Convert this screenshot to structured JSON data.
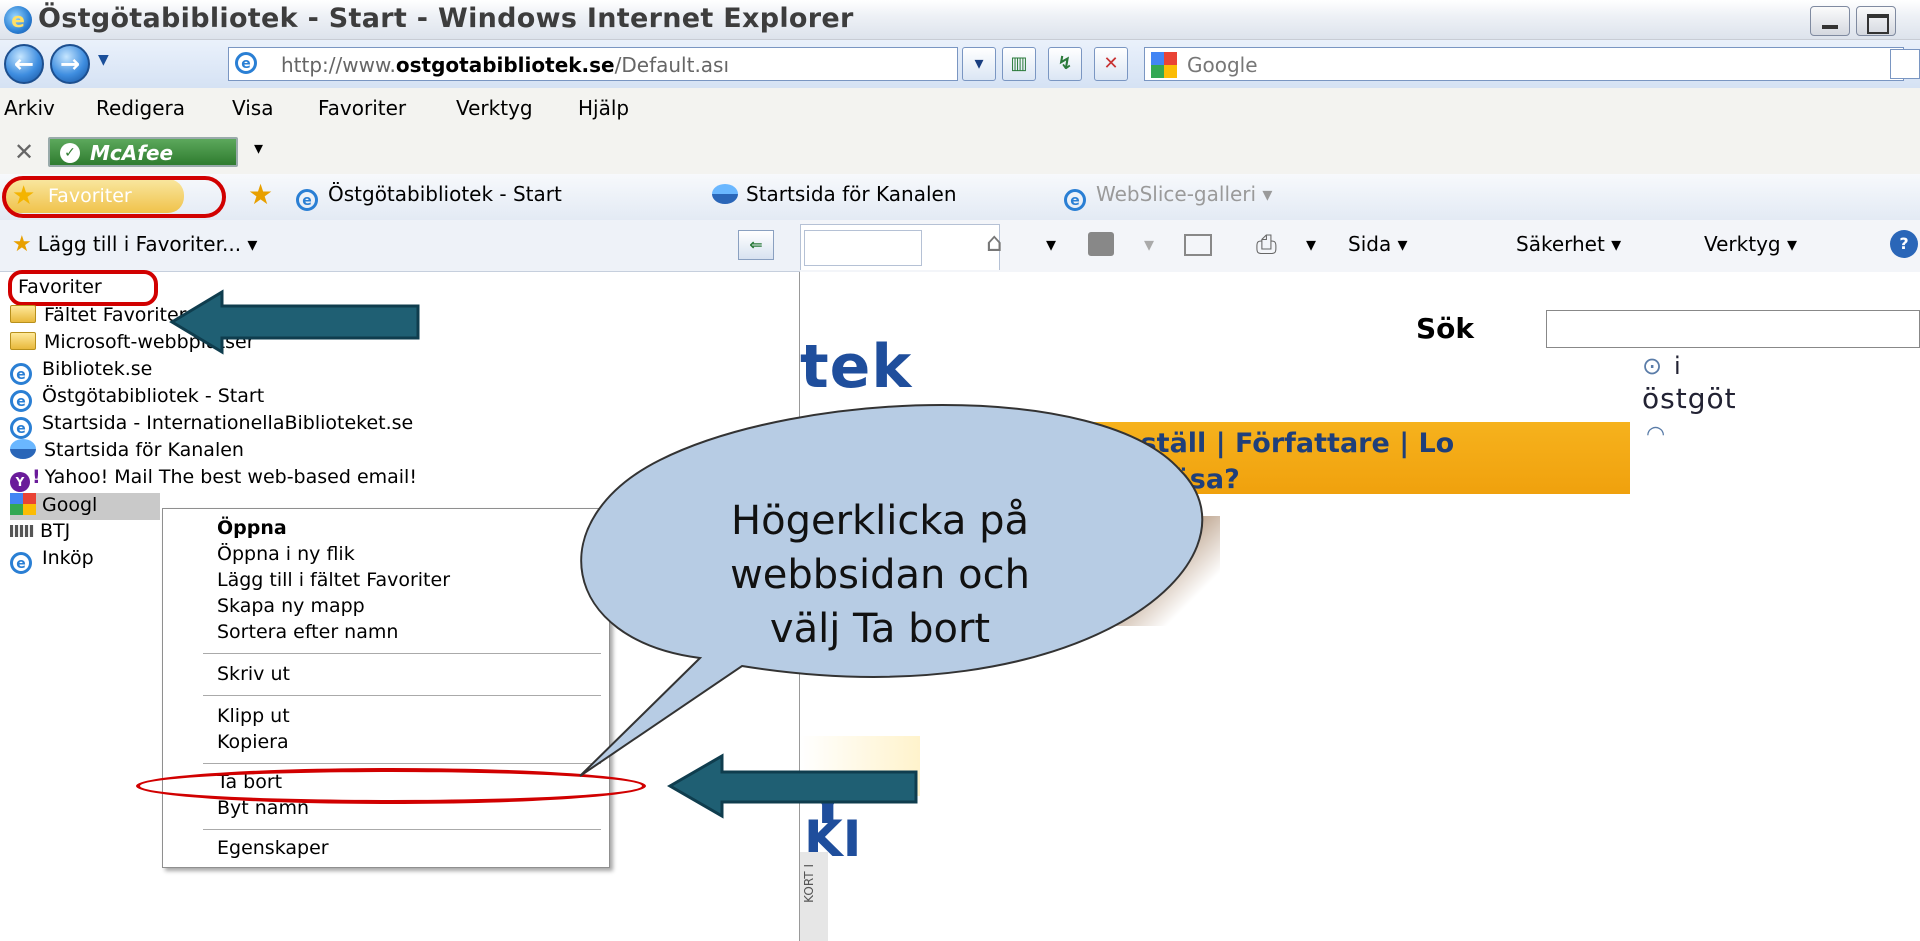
{
  "window": {
    "title": "Östgötabibliotek - Start - Windows Internet Explorer"
  },
  "address_bar": {
    "url_prefix": "http://www.",
    "url_domain": "ostgotabibliotek.se",
    "url_path": "/Default.ası",
    "search_placeholder": "Google"
  },
  "menu": {
    "items": [
      "Arkiv",
      "Redigera",
      "Visa",
      "Favoriter",
      "Verktyg",
      "Hjälp"
    ]
  },
  "toolbar": {
    "mcafee_label": "McAfee"
  },
  "favorites_bar": {
    "center_button": "Favoriter",
    "links": [
      "Östgötabibliotek - Start",
      "Startsida för Kanalen",
      "WebSlice-galleri ▾"
    ]
  },
  "favorites_panel": {
    "add_label": "Lägg till i Favoriter...  ▾",
    "tab_label": "Favoriter",
    "items": [
      {
        "icon": "folder-icon",
        "label": "Fältet Favoriter"
      },
      {
        "icon": "folder-icon",
        "label": "Microsoft-webbplatser"
      },
      {
        "icon": "ie-icon",
        "label": "Bibliotek.se"
      },
      {
        "icon": "ie-icon",
        "label": "Östgötabibliotek - Start"
      },
      {
        "icon": "ie-icon",
        "label": "Startsida - InternationellaBiblioteket.se"
      },
      {
        "icon": "globe-icon",
        "label": "Startsida för Kanalen"
      },
      {
        "icon": "yahoo-icon",
        "label": "Yahoo! Mail The best web-based email!"
      },
      {
        "icon": "google-icon",
        "label": "Googl"
      },
      {
        "icon": "btj-icon",
        "label": "BTJ"
      },
      {
        "icon": "ie-icon",
        "label": "Inköp"
      }
    ]
  },
  "context_menu": {
    "items": [
      "Öppna",
      "Öppna i ny flik",
      "Lägg till i fältet Favoriter",
      "Skapa ny mapp",
      "Sortera efter namn",
      "Skriv ut",
      "Klipp ut",
      "Kopiera",
      "Ta bort",
      "Byt namn",
      "Egenskaper"
    ]
  },
  "command_bar": {
    "sida": "Sida ▾",
    "sakerhet": "Säkerhet ▾",
    "verktyg": "Verktyg ▾"
  },
  "page": {
    "logo_fragment": "tek",
    "search_label": "Sök",
    "radio1_label": "i",
    "radio2_fragment": "östgöt",
    "nav_links": "& beställ | Författare | Lo",
    "nav_svart": "Svårt att läsa?",
    "frag1": "Y",
    "frag2": "KI",
    "vertical_text": "KORT I"
  },
  "callout": {
    "text": "Högerklicka på webbsidan och välj Ta bort"
  },
  "colors": {
    "annotation_red": "#d10000",
    "arrow_teal": "#1f5f73",
    "callout_fill": "#b7cce4"
  }
}
